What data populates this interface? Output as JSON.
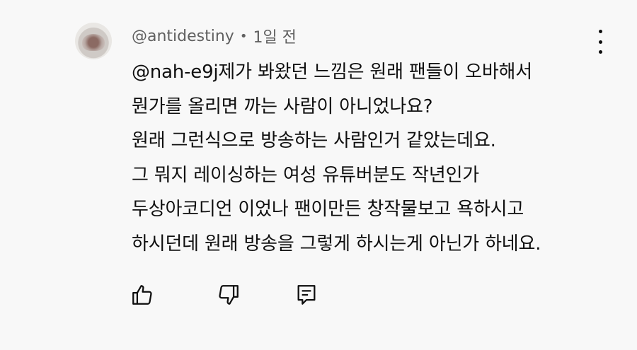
{
  "comment": {
    "author": "@antidestiny",
    "separator": "•",
    "time": "1일 전",
    "lines": [
      "@nah-e9j제가 봐왔던 느낌은 원래 팬들이 오바해서",
      "뭔가를 올리면 까는 사람이 아니었나요?",
      "원래 그런식으로 방송하는 사람인거 같았는데요.",
      "그 뭐지 레이싱하는 여성 유튜버분도 작년인가",
      "두상아코디언 이었나 팬이만든 창작물보고 욕하시고",
      "하시던데 원래 방송을 그렇게 하시는게 아닌가 하네요."
    ]
  },
  "icons": {
    "avatar": "avatar-image",
    "more": "more-vertical-icon",
    "like": "thumbs-up-icon",
    "dislike": "thumbs-down-icon",
    "reply": "reply-comment-icon"
  },
  "colors": {
    "background": "#f8f8f8",
    "text": "#0f0f0f",
    "meta": "#606060"
  }
}
